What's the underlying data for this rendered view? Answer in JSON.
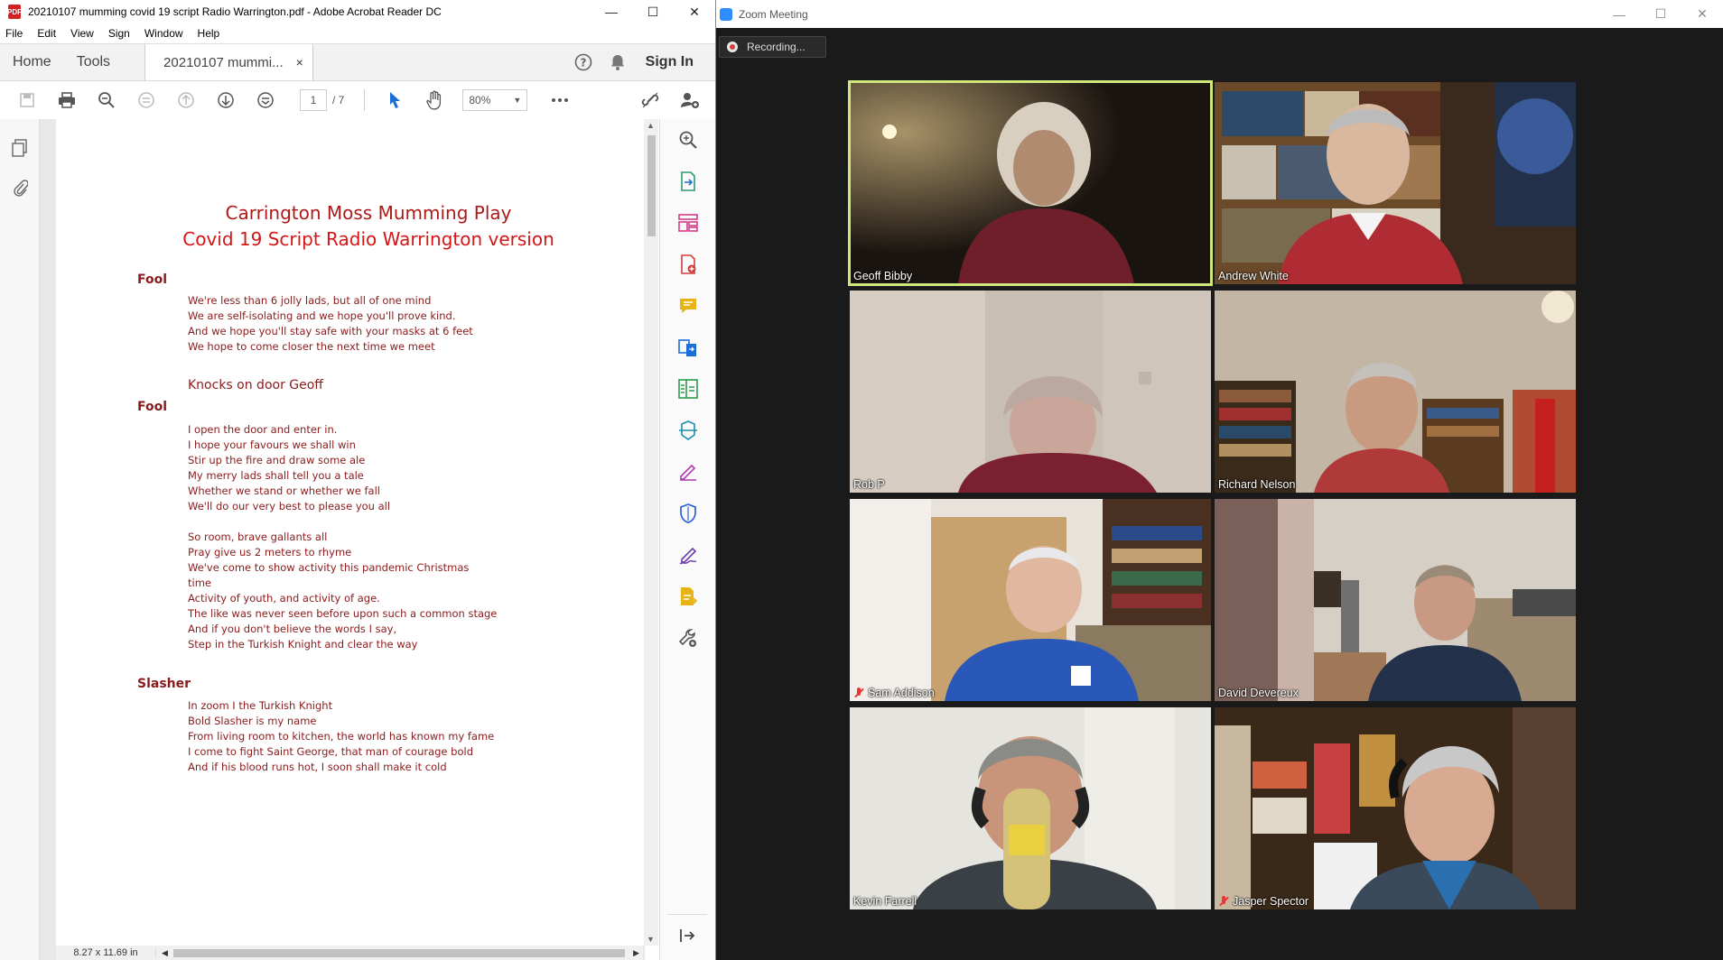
{
  "acrobat": {
    "window_title": "20210107 mumming covid 19 script Radio Warrington.pdf - Adobe Acrobat Reader DC",
    "menu": [
      "File",
      "Edit",
      "View",
      "Sign",
      "Window",
      "Help"
    ],
    "nav": {
      "home": "Home",
      "tools": "Tools",
      "doc_tab": "20210107 mummi...",
      "close_tab": "×",
      "sign_in": "Sign In"
    },
    "toolbar": {
      "page_current": "1",
      "page_total": "/ 7",
      "zoom": "80%"
    },
    "page_size": "8.27 x 11.69 in",
    "document": {
      "title1": "Carrington Moss Mumming Play",
      "title2": "Covid 19 Script Radio Warrington version",
      "speaker1": "Fool",
      "block1": [
        "We're less than 6 jolly lads, but all of one mind",
        "We are self-isolating and we hope you'll prove kind.",
        "And we hope you'll stay safe with your masks at 6 feet",
        "We hope to come closer the next time we meet"
      ],
      "stage1": "Knocks on door Geoff",
      "speaker2": "Fool",
      "block2": [
        "I open the door and enter in.",
        "I hope your favours we shall win",
        "Stir up the fire and draw some ale",
        "My merry lads shall tell you a tale",
        "Whether we stand or whether we fall",
        "We'll do our very best to please you all"
      ],
      "block3": [
        "So room, brave gallants all",
        "Pray give us 2 meters to rhyme",
        "We've come to show activity this pandemic Christmas",
        "time",
        "Activity of youth, and activity of age.",
        "The like was never seen before upon such a common stage",
        "And if you don't believe the words I say,",
        "Step in the Turkish Knight and clear the way"
      ],
      "speaker3": "Slasher",
      "block4": [
        "In zoom I the Turkish Knight",
        "Bold Slasher is my name",
        "From living room to kitchen, the world has known my fame",
        "I come to fight Saint George, that man of courage bold",
        "And if his blood runs hot, I soon shall make it cold"
      ]
    }
  },
  "zoom": {
    "window_title": "Zoom Meeting",
    "recording": "Recording...",
    "participants": [
      {
        "name": "Geoff Bibby",
        "muted": false,
        "active": true
      },
      {
        "name": "Andrew White",
        "muted": false,
        "active": false
      },
      {
        "name": "Rob P",
        "muted": false,
        "active": false
      },
      {
        "name": "Richard Nelson",
        "muted": false,
        "active": false
      },
      {
        "name": "Sam Addison",
        "muted": true,
        "active": false
      },
      {
        "name": "David Devereux",
        "muted": false,
        "active": false
      },
      {
        "name": "Kevin Farrell",
        "muted": false,
        "active": false
      },
      {
        "name": "Jasper Spector",
        "muted": true,
        "active": false
      }
    ],
    "colors": {
      "active_border": "#cfe67a",
      "background": "#1a1a1a"
    }
  }
}
